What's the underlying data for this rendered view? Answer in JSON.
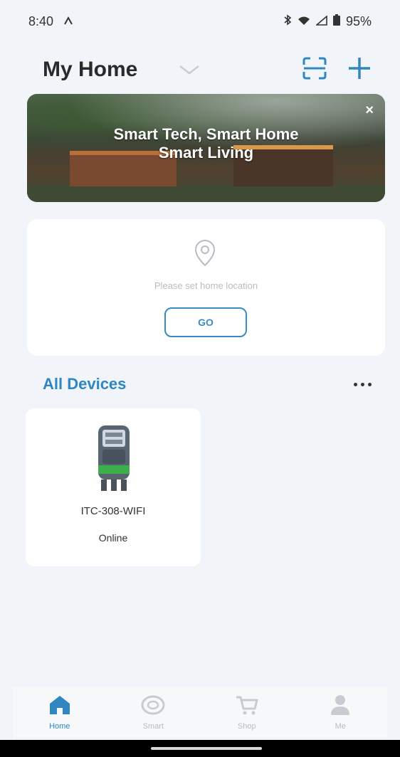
{
  "status_bar": {
    "time": "8:40",
    "battery": "95%"
  },
  "header": {
    "title": "My Home"
  },
  "banner": {
    "line1": "Smart Tech, Smart Home",
    "line2": "Smart Living",
    "close": "×"
  },
  "location_card": {
    "prompt": "Please set home location",
    "go_label": "GO"
  },
  "devices": {
    "title": "All Devices",
    "items": [
      {
        "name": "ITC-308-WIFI",
        "status": "Online"
      }
    ]
  },
  "bottom_nav": {
    "items": [
      {
        "label": "Home",
        "active": true
      },
      {
        "label": "Smart",
        "active": false
      },
      {
        "label": "Shop",
        "active": false
      },
      {
        "label": "Me",
        "active": false
      }
    ]
  },
  "colors": {
    "accent": "#2f86c0",
    "background": "#f1f5f9"
  }
}
